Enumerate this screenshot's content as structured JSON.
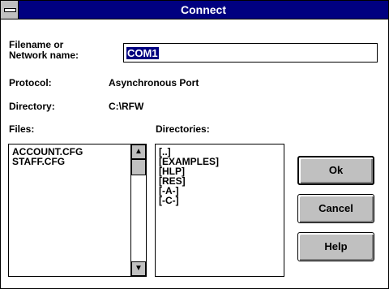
{
  "window": {
    "title": "Connect",
    "colors": {
      "titlebar": "#000080",
      "face": "#c0c0c0",
      "selection": "#000080"
    }
  },
  "filename": {
    "label_line1": "Filename or",
    "label_line2": "Network name:",
    "value": "COM1"
  },
  "protocol": {
    "label": "Protocol:",
    "value": "Asynchronous Port"
  },
  "directory": {
    "label": "Directory:",
    "value": "C:\\RFW"
  },
  "files": {
    "label": "Files:",
    "items": [
      "ACCOUNT.CFG",
      "STAFF.CFG"
    ]
  },
  "directories": {
    "label": "Directories:",
    "items": [
      "[..]",
      "[EXAMPLES]",
      "[HLP]",
      "[RES]",
      "[-A-]",
      "[-C-]"
    ]
  },
  "buttons": {
    "ok": "Ok",
    "cancel": "Cancel",
    "help": "Help"
  },
  "icons": {
    "system_menu": "system-menu-icon",
    "scroll_up": "scroll-up-arrow-icon",
    "scroll_down": "scroll-down-arrow-icon",
    "scroll_up_glyph": "▲",
    "scroll_down_glyph": "▼"
  }
}
